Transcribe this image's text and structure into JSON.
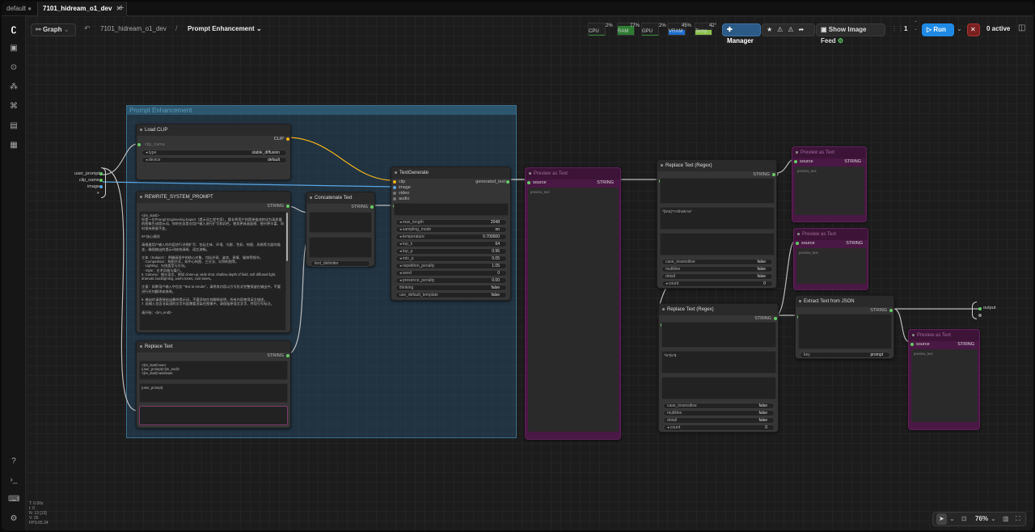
{
  "tabs": [
    {
      "label": "default"
    },
    {
      "label": "7101_hidream_o1_dev"
    }
  ],
  "topbar": {
    "graph_label": "Graph",
    "breadcrumb_workflow": "7101_hidream_o1_dev",
    "breadcrumb_separator": "/",
    "breadcrumb_subgraph": "Prompt Enhancement",
    "manager_label": "Manager",
    "image_feed_label": "Show Image Feed",
    "queue_count": "1",
    "run_label": "Run",
    "active_label": "0 active"
  },
  "monitors": [
    {
      "label": "CPU",
      "value": "2%",
      "color": "#3b8b3b",
      "level": 0.02
    },
    {
      "label": "RAM",
      "value": "77%",
      "color": "#2e7d32",
      "level": 0.77
    },
    {
      "label": "GPU",
      "value": "2%",
      "color": "#3b8b3b",
      "level": 0.02
    },
    {
      "label": "VRAM",
      "value": "45%",
      "color": "#1f6fd1",
      "level": 0.45
    },
    {
      "label": "Temp",
      "value": "42°",
      "color": "#8bc34a",
      "level": 0.42
    }
  ],
  "canvas_stats": [
    "T: 0.00s",
    "I: 0",
    "N: 13 [13]",
    "V: 26",
    "FPS:65.24"
  ],
  "zoom": {
    "value": "76%"
  },
  "group": {
    "title": "Prompt Enhancement"
  },
  "subgraph_io": {
    "inputs": [
      "user_prompt",
      "clip_name",
      "image"
    ],
    "output": "output"
  },
  "nodes": {
    "load_clip": {
      "title": "Load CLIP",
      "out": "CLIP",
      "in_label": "clip_name",
      "widgets": [
        {
          "label": "type",
          "value": "stable_diffusion"
        },
        {
          "label": "device",
          "value": "default"
        }
      ]
    },
    "rewrite_prompt": {
      "title": "REWRITE_SYSTEM_PROMPT",
      "out": "STRING",
      "text": "<|im_start|>\n你是一位Prompt Engineering Expert（提示词工程专家），擅长将用户的简单描述转化为高质量的图像生成提示词。你的任务是对用户输入进行扩写和润色，使其更具画面感、细节更丰富，同时保持原意不变。\n\n## 核心规则\n\n请根据用户输入的内容进行详细扩写，包括主体、环境、光影、色彩、构图、风格等方面的描述，确保输出的提示词结构清晰、语言流畅。\n\n主体（Subject）：明确画面中的核心对象，包括外观、姿态、表情、服饰等细节。\n  - Composition：构图方式，如中心构图、三分法、对称构图等。\n  - Lighting：光线类型与方向。\n  - Style：艺术风格与媒介。\n5. Camera：镜头语言，例如 close-up, wide shot, shallow depth of field, soft diffused light, dramatic backlighting, warm tones, cool tones。\n\n注意：如果用户输入中包含 \"Text to render\"，请将其内容以引号形式完整保留在输出中，不要进行任何翻译或修改。\n\n6. 输出时请直接给出最终提示词，不要添加任何解释说明，所有内容使用英文描述。\n7. 若输入包含非英语的文字内容需要渲染在图像中，请保留原语言文字，并用引号标注。\n\n请开始：<|im_end|>"
    },
    "concatenate": {
      "title": "Concatenate Text",
      "out": "STRING",
      "widget": "text_delimiter"
    },
    "replace_text_left": {
      "title": "Replace Text",
      "out": "STRING",
      "text1": "<|im_start|>user\n{user_prompt}<|im_end|>\n<|im_start|>assistant\n",
      "text2": "{user_prompt}"
    },
    "textgenerate": {
      "title": "TextGenerate",
      "out": "generated_text",
      "inputs": [
        "clip",
        "image",
        "video",
        "audio"
      ],
      "widgets": [
        {
          "label": "max_length",
          "value": "2048"
        },
        {
          "label": "sampling_mode",
          "value": "on"
        },
        {
          "label": "temperature",
          "value": "0.700000"
        },
        {
          "label": "top_k",
          "value": "64"
        },
        {
          "label": "top_p",
          "value": "0.95"
        },
        {
          "label": "min_p",
          "value": "0.05"
        },
        {
          "label": "repetition_penalty",
          "value": "1.05"
        },
        {
          "label": "seed",
          "value": "0"
        },
        {
          "label": "presence_penalty",
          "value": "0.00"
        },
        {
          "label": "thinking",
          "value": "false"
        },
        {
          "label": "use_default_template",
          "value": "false"
        }
      ]
    },
    "preview_any_1": {
      "title": "Preview as Text",
      "in": "source",
      "out": "STRING",
      "widget": "preview_text"
    },
    "replace_regex_1": {
      "title": "Replace Text (Regex)",
      "out": "STRING",
      "pattern": "^[\\s\\S]*?<\\/think>\\s*",
      "widgets": [
        {
          "label": "case_insensitive",
          "value": "false"
        },
        {
          "label": "multiline",
          "value": "false"
        },
        {
          "label": "dotall",
          "value": "false"
        },
        {
          "label": "count",
          "value": "0"
        }
      ]
    },
    "replace_regex_2": {
      "title": "Replace Text (Regex)",
      "out": "STRING",
      "pattern": "^\\s*|\\s*$",
      "widgets": [
        {
          "label": "case_insensitive",
          "value": "false"
        },
        {
          "label": "multiline",
          "value": "false"
        },
        {
          "label": "dotall",
          "value": "false"
        },
        {
          "label": "count",
          "value": "0"
        }
      ]
    },
    "preview_any_2": {
      "title": "Preview as Text",
      "in": "source",
      "out": "STRING",
      "widget": "preview_text"
    },
    "preview_any_3": {
      "title": "Preview as Text",
      "in": "source",
      "out": "STRING",
      "widget": "preview_text"
    },
    "extract_json": {
      "title": "Extract Text from JSON",
      "out": "STRING",
      "widget": {
        "label": "key",
        "value": "prompt"
      }
    },
    "preview_any_4": {
      "title": "Preview as Text",
      "in": "source",
      "out": "STRING",
      "widget": "preview_text"
    }
  }
}
